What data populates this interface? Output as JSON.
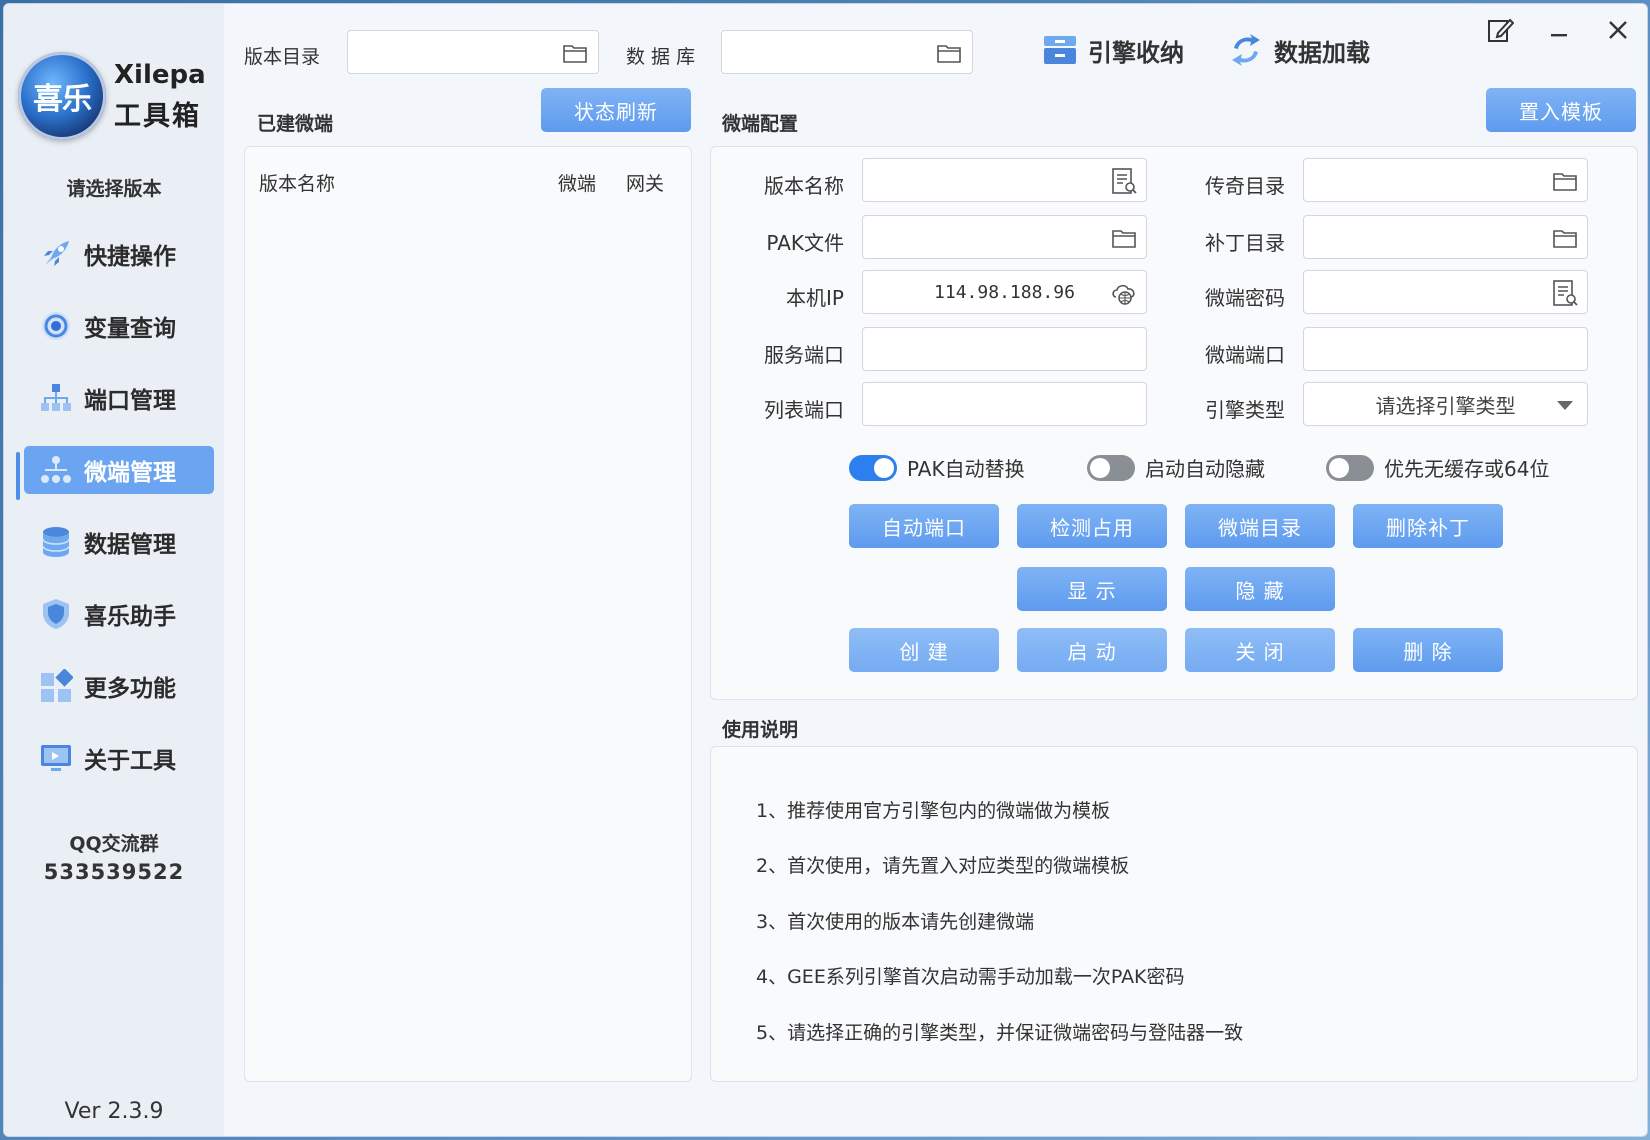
{
  "sidebar": {
    "logo_text": "喜乐",
    "app_name": "Xilepa",
    "app_subtitle": "工具箱",
    "select_version": "请选择版本",
    "items": [
      {
        "label": "快捷操作",
        "icon": "rocket-icon"
      },
      {
        "label": "变量查询",
        "icon": "target-icon"
      },
      {
        "label": "端口管理",
        "icon": "network-icon"
      },
      {
        "label": "微端管理",
        "icon": "topology-icon",
        "active": true
      },
      {
        "label": "数据管理",
        "icon": "database-icon"
      },
      {
        "label": "喜乐助手",
        "icon": "shield-icon"
      },
      {
        "label": "更多功能",
        "icon": "grid-icon"
      },
      {
        "label": "关于工具",
        "icon": "monitor-icon"
      }
    ],
    "qq_label": "QQ交流群",
    "qq_number": "533539522",
    "version": "Ver 2.3.9"
  },
  "topbar": {
    "version_dir_label": "版本目录",
    "version_dir_value": "",
    "database_label": "数 据 库",
    "database_value": "",
    "engine_store": "引擎收纳",
    "data_load": "数据加载"
  },
  "built_panel": {
    "title": "已建微端",
    "refresh_button": "状态刷新",
    "columns": [
      "版本名称",
      "微端",
      "网关"
    ]
  },
  "config_panel": {
    "title": "微端配置",
    "template_button": "置入模板",
    "fields": {
      "version_name": {
        "label": "版本名称",
        "value": ""
      },
      "legend_dir": {
        "label": "传奇目录",
        "value": ""
      },
      "pak_file": {
        "label": "PAK文件",
        "value": ""
      },
      "patch_dir": {
        "label": "补丁目录",
        "value": ""
      },
      "local_ip": {
        "label": "本机IP",
        "value": "114.98.188.96"
      },
      "client_password": {
        "label": "微端密码",
        "value": ""
      },
      "service_port": {
        "label": "服务端口",
        "value": ""
      },
      "client_port": {
        "label": "微端端口",
        "value": ""
      },
      "list_port": {
        "label": "列表端口",
        "value": ""
      },
      "engine_type": {
        "label": "引擎类型",
        "value": "请选择引擎类型"
      }
    },
    "toggles": [
      {
        "label": "PAK自动替换",
        "on": true
      },
      {
        "label": "启动自动隐藏",
        "on": false
      },
      {
        "label": "优先无缓存或64位",
        "on": false
      }
    ],
    "buttons_row1": [
      "自动端口",
      "检测占用",
      "微端目录",
      "删除补丁"
    ],
    "buttons_row2": [
      "显 示",
      "隐 藏"
    ],
    "buttons_row3": [
      "创 建",
      "启 动",
      "关 闭",
      "删 除"
    ]
  },
  "usage": {
    "title": "使用说明",
    "lines": [
      "1、推荐使用官方引擎包内的微端做为模板",
      "2、首次使用，请先置入对应类型的微端模板",
      "3、首次使用的版本请先创建微端",
      "4、GEE系列引擎首次启动需手动加载一次PAK密码",
      "5、请选择正确的引擎类型，并保证微端密码与登陆器一致"
    ]
  },
  "colors": {
    "accent": "#5e9bee",
    "toggle_on": "#2d7ff0",
    "toggle_off": "#8a8f96"
  }
}
